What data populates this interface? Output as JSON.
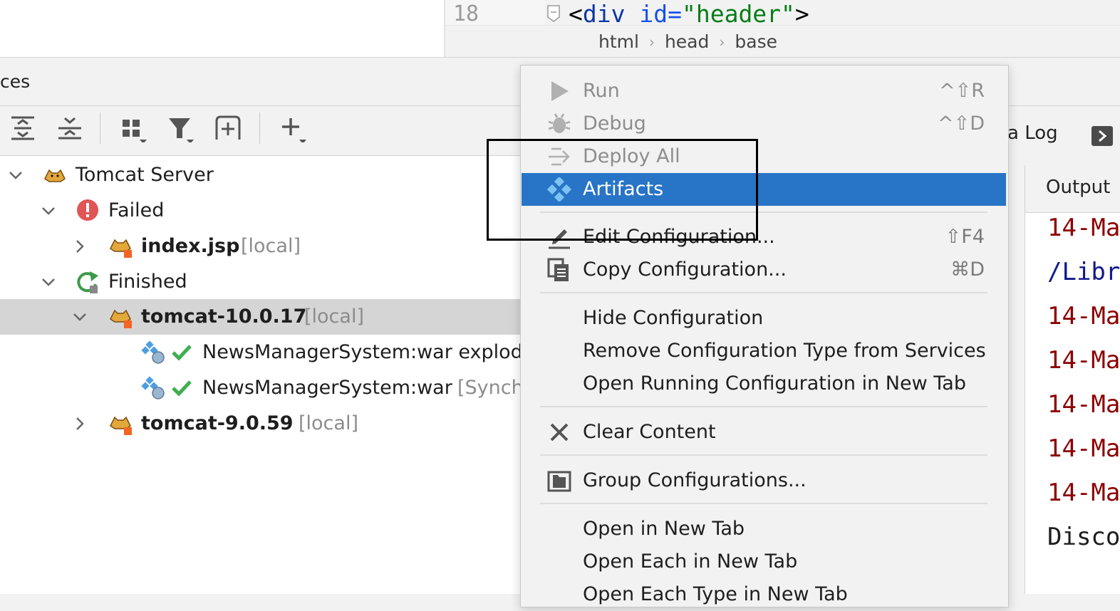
{
  "editor": {
    "line_number": "18",
    "code": {
      "open": "<",
      "tag": "div",
      "attr": " id=",
      "value": "\"header\"",
      "close": ">"
    },
    "breadcrumb": [
      "html",
      "head",
      "base"
    ]
  },
  "services_panel": {
    "title": "ces",
    "toolbar": [
      "expand-all-icon",
      "collapse-all-icon",
      "group-icon",
      "filter-icon",
      "add-service-icon",
      "add-icon"
    ],
    "tree": [
      {
        "label": "Tomcat Server",
        "suffix": "",
        "icon": "tomcat-icon",
        "expanded": true
      },
      {
        "label": "Failed",
        "suffix": "",
        "icon": "error-icon",
        "expanded": true
      },
      {
        "label": "index.jsp",
        "suffix": "[local]",
        "icon": "tomcat-icon",
        "expanded": false
      },
      {
        "label": "Finished",
        "suffix": "",
        "icon": "finished-icon",
        "expanded": true
      },
      {
        "label": "tomcat-10.0.17",
        "suffix": "[local]",
        "icon": "tomcat-icon",
        "expanded": true,
        "selected": true
      },
      {
        "label": "NewsManagerSystem:war explod",
        "suffix": "",
        "icon": "artifact-icon"
      },
      {
        "label": "NewsManagerSystem:war",
        "suffix": "[Synch",
        "icon": "artifact-icon"
      },
      {
        "label": "tomcat-9.0.59",
        "suffix": "[local]",
        "icon": "tomcat-icon",
        "expanded": false
      }
    ]
  },
  "right_panel": {
    "tab_label": "a Log",
    "output_label": "Output",
    "console_lines": [
      {
        "text": "14-Ma",
        "color": "#8b0000"
      },
      {
        "text": "/Libr",
        "color": "#0f1a8c"
      },
      {
        "text": "14-Ma",
        "color": "#8b0000"
      },
      {
        "text": "14-Ma",
        "color": "#8b0000"
      },
      {
        "text": "14-Ma",
        "color": "#8b0000"
      },
      {
        "text": "14-Ma",
        "color": "#8b0000"
      },
      {
        "text": "14-Ma",
        "color": "#8b0000"
      },
      {
        "text": "Disco",
        "color": "#1e1e1e"
      }
    ]
  },
  "context_menu": {
    "items": [
      {
        "label": "Run",
        "shortcut": "^⇧R",
        "icon": "run-icon",
        "disabled": true
      },
      {
        "label": "Debug",
        "shortcut": "^⇧D",
        "icon": "debug-icon",
        "disabled": true
      },
      {
        "label": "Deploy All",
        "shortcut": "",
        "icon": "deploy-icon",
        "disabled": true
      },
      {
        "label": "Artifacts",
        "shortcut": "",
        "icon": "artifacts-icon",
        "highlighted": true
      },
      {
        "label": "Edit Configuration...",
        "shortcut": "⇧F4",
        "icon": "edit-icon"
      },
      {
        "label": "Copy Configuration...",
        "shortcut": "⌘D",
        "icon": "copy-icon"
      },
      {
        "label": "Hide Configuration",
        "shortcut": ""
      },
      {
        "label": "Remove Configuration Type from Services",
        "shortcut": ""
      },
      {
        "label": "Open Running Configuration in New Tab",
        "shortcut": ""
      },
      {
        "label": "Clear Content",
        "shortcut": "",
        "icon": "clear-icon"
      },
      {
        "label": "Group Configurations...",
        "shortcut": "",
        "icon": "folder-icon"
      },
      {
        "label": "Open in New Tab",
        "shortcut": ""
      },
      {
        "label": "Open Each in New Tab",
        "shortcut": ""
      },
      {
        "label": "Open Each Type in New Tab",
        "shortcut": ""
      }
    ]
  },
  "colors": {
    "highlight": "#2874c6",
    "selection": "#d5d5d5",
    "console_error": "#8b0000",
    "console_path": "#0f1a8c"
  }
}
